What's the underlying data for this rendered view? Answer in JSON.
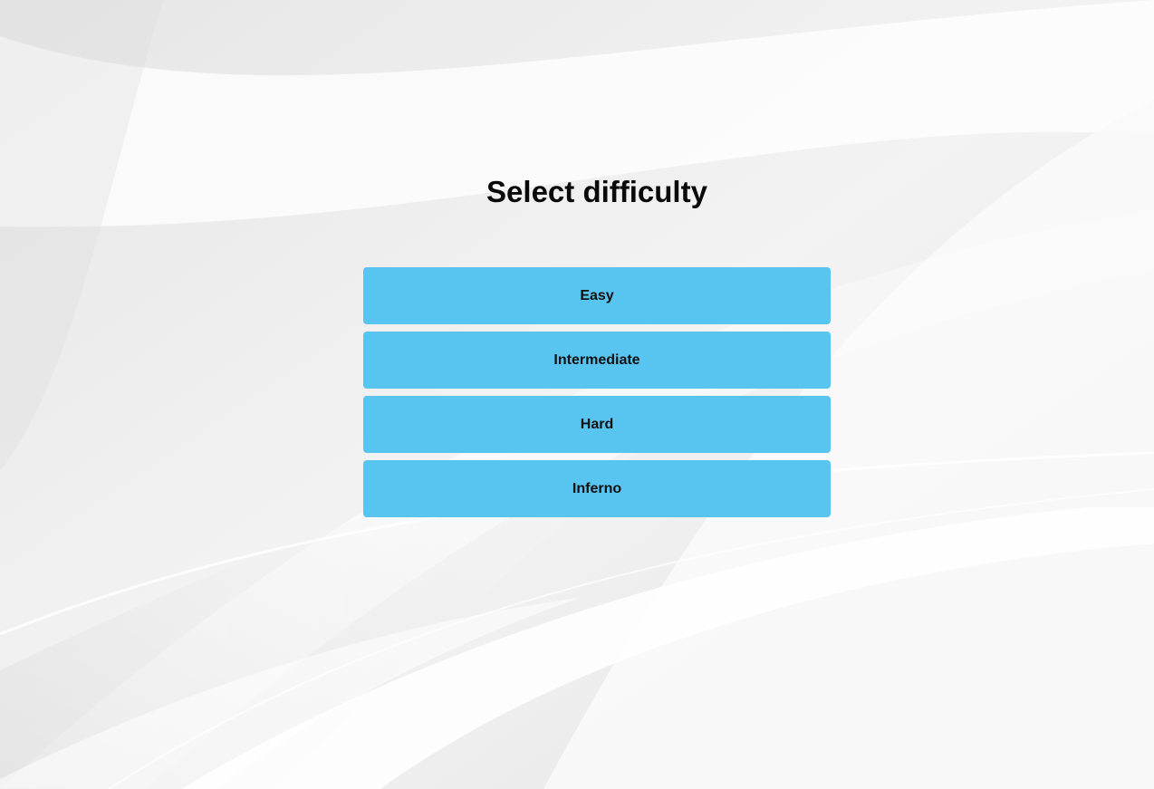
{
  "screen": {
    "title": "Select difficulty"
  },
  "difficulty_options": [
    {
      "label": "Easy"
    },
    {
      "label": "Intermediate"
    },
    {
      "label": "Hard"
    },
    {
      "label": "Inferno"
    }
  ],
  "colors": {
    "button_background": "#58c4f0",
    "button_text": "#111111",
    "title_text": "#0a0a0a",
    "page_background": "#ececec"
  }
}
